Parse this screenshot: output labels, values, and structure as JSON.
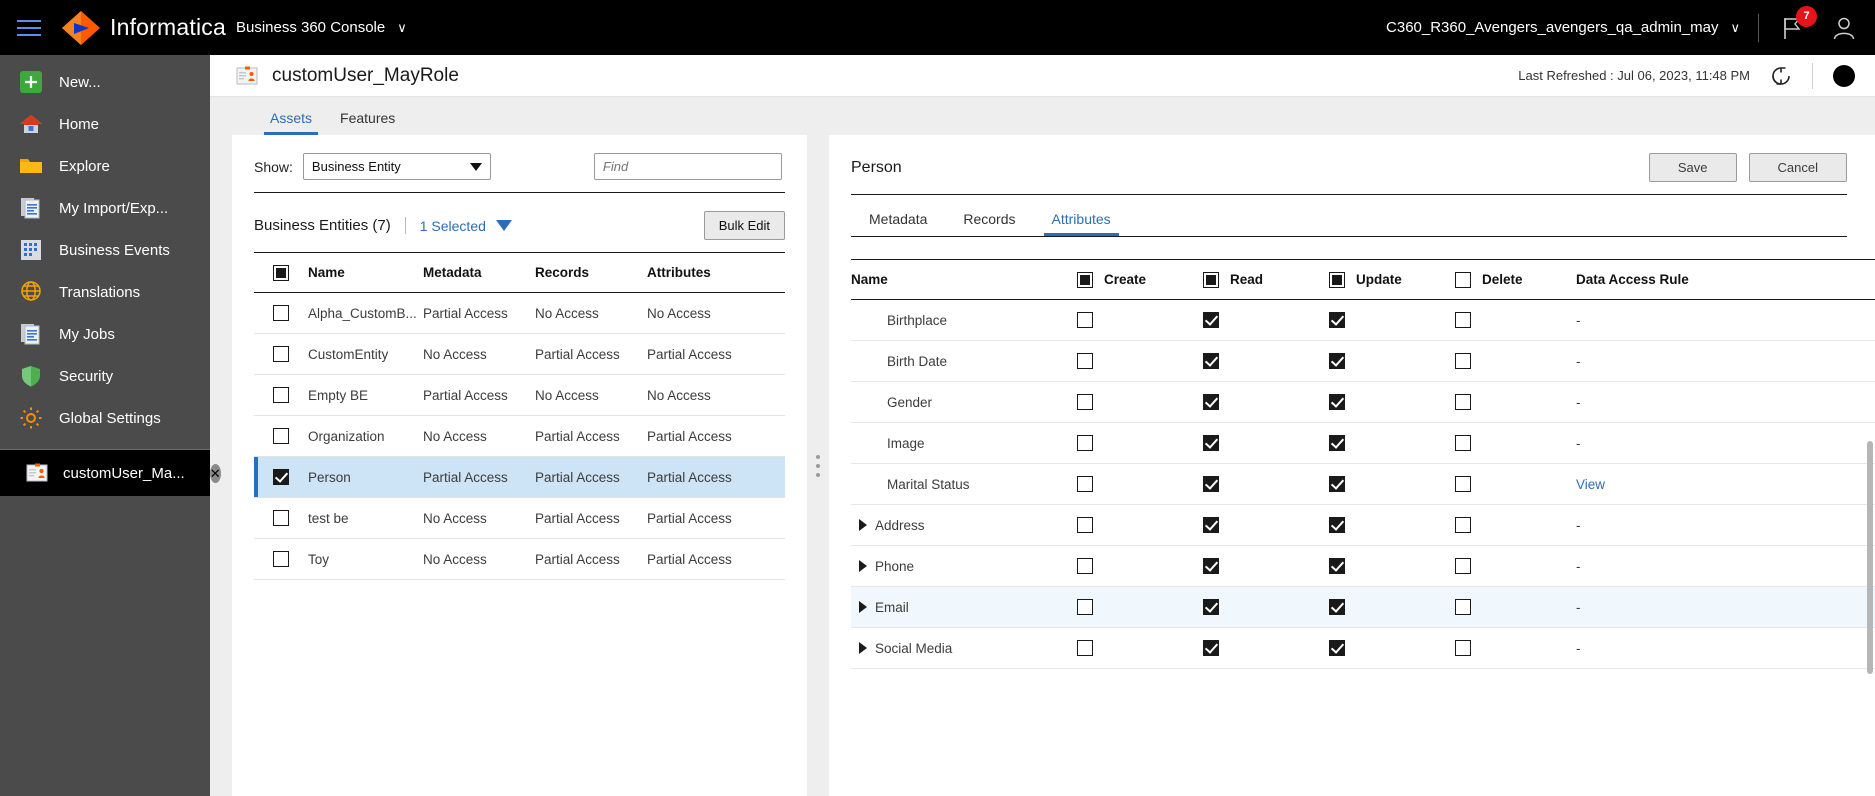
{
  "topbar": {
    "menu_icon": "hamburger-icon",
    "brand": "Informatica",
    "brand_sub": "Business 360 Console",
    "brand_caret": "∨",
    "org": "C360_R360_Avengers_avengers_qa_admin_may",
    "org_caret": "∨",
    "flag_icon": "flag-icon",
    "notification_count": "7",
    "avatar_icon": "user-avatar-icon"
  },
  "sidebar": {
    "items": [
      {
        "label": "New...",
        "icon": "plus-icon"
      },
      {
        "label": "Home",
        "icon": "home-icon"
      },
      {
        "label": "Explore",
        "icon": "folder-icon"
      },
      {
        "label": "My Import/Exp...",
        "icon": "import-export-icon"
      },
      {
        "label": "Business Events",
        "icon": "business-events-icon"
      },
      {
        "label": "Translations",
        "icon": "globe-icon"
      },
      {
        "label": "My Jobs",
        "icon": "jobs-icon"
      },
      {
        "label": "Security",
        "icon": "shield-icon"
      },
      {
        "label": "Global Settings",
        "icon": "gear-icon"
      }
    ],
    "active_tab": {
      "label": "customUser_Ma...",
      "icon": "role-badge-icon",
      "close": "✕"
    }
  },
  "page": {
    "title": "customUser_MayRole",
    "title_icon": "role-badge-icon",
    "last_refreshed": "Last Refreshed : Jul 06, 2023, 11:48 PM",
    "refresh_icon": "refresh-icon",
    "tabs": [
      {
        "label": "Assets",
        "active": true
      },
      {
        "label": "Features",
        "active": false
      }
    ]
  },
  "left_panel": {
    "show_label": "Show:",
    "show_value": "Business Entity",
    "find_placeholder": "Find",
    "count_label": "Business Entities (7)",
    "selected_label": "1 Selected",
    "bulk_edit_label": "Bulk Edit",
    "columns": [
      "Name",
      "Metadata",
      "Records",
      "Attributes"
    ],
    "header_checkbox_state": "indeterminate",
    "rows": [
      {
        "checked": false,
        "name": "Alpha_CustomB...",
        "metadata": "Partial Access",
        "records": "No Access",
        "attributes": "No Access"
      },
      {
        "checked": false,
        "name": "CustomEntity",
        "metadata": "No Access",
        "records": "Partial Access",
        "attributes": "Partial Access"
      },
      {
        "checked": false,
        "name": "Empty BE",
        "metadata": "Partial Access",
        "records": "No Access",
        "attributes": "No Access"
      },
      {
        "checked": false,
        "name": "Organization",
        "metadata": "No Access",
        "records": "Partial Access",
        "attributes": "Partial Access"
      },
      {
        "checked": true,
        "name": "Person",
        "metadata": "Partial Access",
        "records": "Partial Access",
        "attributes": "Partial Access"
      },
      {
        "checked": false,
        "name": "test be",
        "metadata": "No Access",
        "records": "Partial Access",
        "attributes": "Partial Access"
      },
      {
        "checked": false,
        "name": "Toy",
        "metadata": "No Access",
        "records": "Partial Access",
        "attributes": "Partial Access"
      }
    ]
  },
  "right_panel": {
    "title": "Person",
    "save_label": "Save",
    "cancel_label": "Cancel",
    "tabs": [
      {
        "label": "Metadata",
        "active": false
      },
      {
        "label": "Records",
        "active": false
      },
      {
        "label": "Attributes",
        "active": true
      }
    ],
    "columns": {
      "name": "Name",
      "create": "Create",
      "read": "Read",
      "update": "Update",
      "delete": "Delete",
      "data_access_rule": "Data Access Rule"
    },
    "header_checkbox_states": {
      "create": "indeterminate",
      "read": "indeterminate",
      "update": "indeterminate",
      "delete": "unchecked"
    },
    "rows": [
      {
        "name": "Birthplace",
        "expandable": false,
        "create": false,
        "read": true,
        "update": true,
        "delete": false,
        "rule": "-"
      },
      {
        "name": "Birth Date",
        "expandable": false,
        "create": false,
        "read": true,
        "update": true,
        "delete": false,
        "rule": "-"
      },
      {
        "name": "Gender",
        "expandable": false,
        "create": false,
        "read": true,
        "update": true,
        "delete": false,
        "rule": "-"
      },
      {
        "name": "Image",
        "expandable": false,
        "create": false,
        "read": true,
        "update": true,
        "delete": false,
        "rule": "-"
      },
      {
        "name": "Marital Status",
        "expandable": false,
        "create": false,
        "read": true,
        "update": true,
        "delete": false,
        "rule": "View",
        "rule_link": true
      },
      {
        "name": "Address",
        "expandable": true,
        "create": false,
        "read": true,
        "update": true,
        "delete": false,
        "rule": "-"
      },
      {
        "name": "Phone",
        "expandable": true,
        "create": false,
        "read": true,
        "update": true,
        "delete": false,
        "rule": "-"
      },
      {
        "name": "Email",
        "expandable": true,
        "create": false,
        "read": true,
        "update": true,
        "delete": false,
        "rule": "-",
        "highlight": true
      },
      {
        "name": "Social Media",
        "expandable": true,
        "create": false,
        "read": true,
        "update": true,
        "delete": false,
        "rule": "-"
      }
    ]
  },
  "colors": {
    "accent_blue": "#2a6ebb",
    "brand_orange": "#ff5a00",
    "badge_red": "#e8121a",
    "selected_row": "#cde4f7",
    "topbar_black": "#000000",
    "sidebar_gray": "#4b4b4b"
  }
}
